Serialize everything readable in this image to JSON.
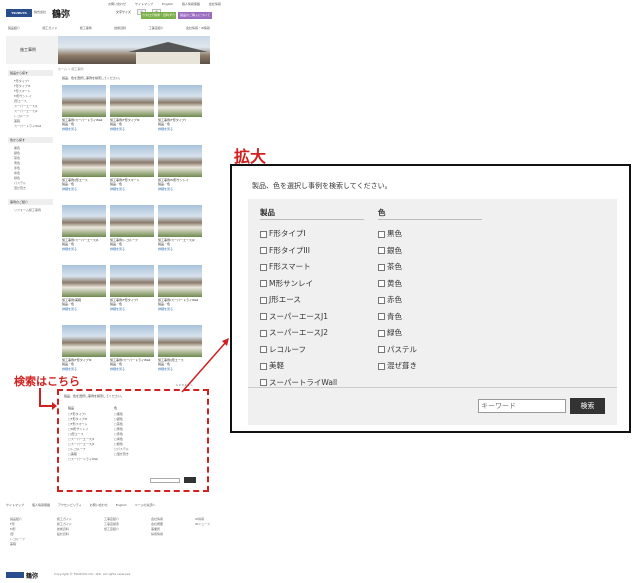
{
  "header": {
    "logo_brand": "TSURUYA",
    "logo_mark": "株式会社",
    "logo_name": "鶴弥",
    "toplinks": [
      "お問い合わせ",
      "サイトマップ",
      "English",
      "個人情報保護",
      "会社情報"
    ],
    "size_label": "文字サイズ",
    "size_small": "小",
    "size_large": "大",
    "green_btn": "カタログ請求・資料ダウンロード",
    "purple_btn": "製品のご購入について"
  },
  "gnav": [
    "製品紹介",
    "施工ガイド",
    "施工事例",
    "技術資料",
    "工事店紹介",
    "会社情報・IR情報"
  ],
  "title": {
    "label": "施工事例"
  },
  "breadcrumb": "ホーム > 施工事例",
  "sidebar": {
    "section1_title": "製品から探す",
    "section1_items": [
      "F形タイプI",
      "F形タイプIII",
      "F形スマート",
      "M形サンレイ",
      "J形エース",
      "スーパーエースJ1",
      "スーパーエースJ2",
      "レコルーフ",
      "美軽",
      "スーパートライWall"
    ],
    "section2_title": "色から探す",
    "section2_items": [
      "黒色",
      "銀色",
      "茶色",
      "黄色",
      "赤色",
      "青色",
      "緑色",
      "パステル",
      "混ぜ葺き"
    ],
    "section3_title": "事例のご紹介",
    "section3_items": [
      "リフォーム施工事例"
    ]
  },
  "intro_text": "製品、色を選択し事例を検索してください。",
  "cases": [
    {
      "caption": "施工事例/スーパートライWall",
      "sub": "製品／色",
      "link": "詳細を見る"
    },
    {
      "caption": "施工事例/F形タイプIII",
      "sub": "製品／色",
      "link": "詳細を見る"
    },
    {
      "caption": "施工事例/F形タイプI",
      "sub": "製品／色",
      "link": "詳細を見る"
    },
    {
      "caption": "施工事例/J形エース",
      "sub": "製品／色",
      "link": "詳細を見る"
    },
    {
      "caption": "施工事例/F形スマート",
      "sub": "製品／色",
      "link": "詳細を見る"
    },
    {
      "caption": "施工事例/M形サンレイ",
      "sub": "製品／色",
      "link": "詳細を見る"
    },
    {
      "caption": "施工事例/スーパーエースJ1",
      "sub": "製品／色",
      "link": "詳細を見る"
    },
    {
      "caption": "施工事例/レコルーフ",
      "sub": "製品／色",
      "link": "詳細を見る"
    },
    {
      "caption": "施工事例/スーパーエースJ2",
      "sub": "製品／色",
      "link": "詳細を見る"
    },
    {
      "caption": "施工事例/美軽",
      "sub": "製品／色",
      "link": "詳細を見る"
    },
    {
      "caption": "施工事例/F形タイプI",
      "sub": "製品／色",
      "link": "詳細を見る"
    },
    {
      "caption": "施工事例/スーパートライWall",
      "sub": "製品／色",
      "link": "詳細を見る"
    },
    {
      "caption": "施工事例/F形タイプIII",
      "sub": "製品／色",
      "link": "詳細を見る"
    },
    {
      "caption": "施工事例/スーパートライWall",
      "sub": "製品／色",
      "link": "詳細を見る"
    },
    {
      "caption": "施工事例/J形エース",
      "sub": "製品／色",
      "link": "詳細を見る"
    }
  ],
  "pager": "1 2 3 4 5 >",
  "search_annotation": "検索はこちら",
  "zoom_label": "拡大",
  "search": {
    "intro": "製品、色を選択し事例を検索してください。",
    "product_header": "製品",
    "color_header": "色",
    "products": [
      "F形タイプI",
      "F形タイプIII",
      "F形スマート",
      "M形サンレイ",
      "J形エース",
      "スーパーエースJ1",
      "スーパーエースJ2",
      "レコルーフ",
      "美軽",
      "スーパートライWall"
    ],
    "colors": [
      "黒色",
      "銀色",
      "茶色",
      "黄色",
      "赤色",
      "青色",
      "緑色",
      "パステル",
      "混ぜ葺き"
    ],
    "keyword_placeholder": "キーワード",
    "search_button": "検索"
  },
  "footer": {
    "bar": [
      "サイトマップ",
      "個人情報保護",
      "アクセシビリティ",
      "お問い合わせ",
      "English",
      "ページの先頭へ"
    ],
    "col1_title": "製品紹介",
    "col1": [
      "F形",
      "M形",
      "J形",
      "レコルーフ",
      "美軽"
    ],
    "col2_title": "施工ガイド",
    "col2": [
      "施工ガイド",
      "技術資料",
      "設計資料"
    ],
    "col3_title": "工事店紹介",
    "col3": [
      "工事店検索",
      "施工店紹介"
    ],
    "col4_title": "会社情報",
    "col4": [
      "会社概要",
      "事業所",
      "採用情報"
    ],
    "col5_title": "IR情報",
    "col5": [
      "IRニュース"
    ],
    "logo_name": "鶴弥",
    "copyright": "Copyright © TSURUYA CO., LTD. All rights reserved."
  }
}
